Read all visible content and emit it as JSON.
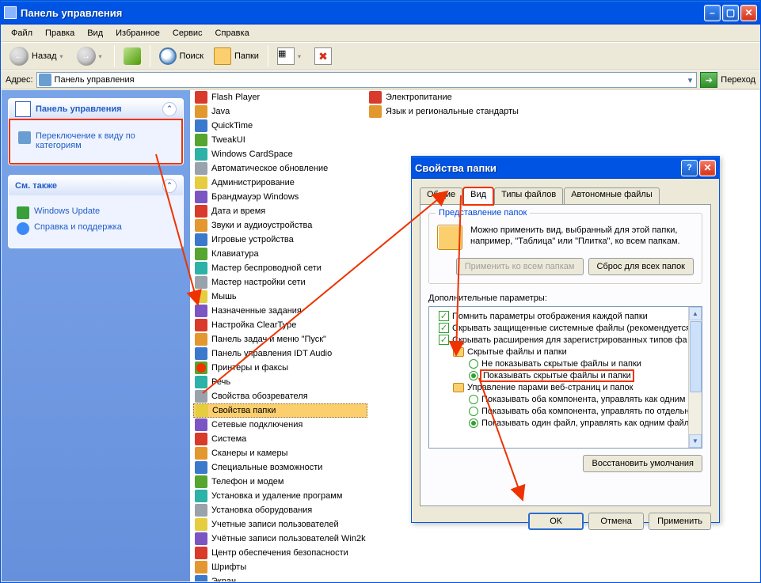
{
  "window": {
    "title": "Панель управления",
    "menu": [
      "Файл",
      "Правка",
      "Вид",
      "Избранное",
      "Сервис",
      "Справка"
    ],
    "toolbar": {
      "back": "Назад",
      "search": "Поиск",
      "folders": "Папки"
    },
    "address": {
      "label": "Адрес:",
      "value": "Панель управления",
      "go": "Переход"
    }
  },
  "sidebar": {
    "box1": {
      "title": "Панель управления",
      "items": [
        {
          "label": "Переключение к виду по категориям"
        }
      ]
    },
    "box2": {
      "title": "См. также",
      "items": [
        {
          "label": "Windows Update"
        },
        {
          "label": "Справка и поддержка"
        }
      ]
    }
  },
  "cp_col1": [
    "Flash Player",
    "Java",
    "QuickTime",
    "TweakUI",
    "Windows CardSpace",
    "Автоматическое обновление",
    "Администрирование",
    "Брандмауэр Windows",
    "Дата и время",
    "Звуки и аудиоустройства",
    "Игровые устройства",
    "Клавиатура",
    "Мастер беспроводной сети",
    "Мастер настройки сети",
    "Мышь",
    "Назначенные задания",
    "Настройка ClearType",
    "Панель задач и меню \"Пуск\"",
    "Панель управления IDT Audio",
    "Принтеры и факсы",
    "Речь",
    "Свойства обозревателя",
    "Свойства папки",
    "Сетевые подключения",
    "Система",
    "Сканеры и камеры",
    "Специальные возможности",
    "Телефон и модем",
    "Установка и удаление программ",
    "Установка оборудования",
    "Учетные записи пользователей",
    "Учётные записи пользователей Win2k",
    "Центр обеспечения безопасности",
    "Шрифты",
    "Экран"
  ],
  "cp_col2": [
    "Электропитание",
    "Язык и региональные стандарты"
  ],
  "dialog": {
    "title": "Свойства папки",
    "tabs": [
      "Общие",
      "Вид",
      "Типы файлов",
      "Автономные файлы"
    ],
    "group1": {
      "title": "Представление папок",
      "text": "Можно применить вид, выбранный для этой папки, например, \"Таблица\" или \"Плитка\", ко всем папкам.",
      "btn_apply_all": "Применить ко всем папкам",
      "btn_reset": "Сброс для всех папок"
    },
    "advanced_label": "Дополнительные параметры:",
    "tree": [
      {
        "type": "check",
        "checked": true,
        "label": "Помнить параметры отображения каждой папки"
      },
      {
        "type": "check",
        "checked": true,
        "label": "Скрывать защищенные системные файлы (рекомендуется"
      },
      {
        "type": "check",
        "checked": true,
        "label": "Скрывать расширения для зарегистрированных типов фа"
      },
      {
        "type": "folder",
        "label": "Скрытые файлы и папки"
      },
      {
        "type": "radio",
        "sel": false,
        "indent": 3,
        "label": "Не показывать скрытые файлы и папки"
      },
      {
        "type": "radio",
        "sel": true,
        "indent": 3,
        "label": "Показывать скрытые файлы и папки",
        "highlight": true
      },
      {
        "type": "folder",
        "label": "Управление парами веб-страниц и папок"
      },
      {
        "type": "radio",
        "sel": false,
        "indent": 3,
        "label": "Показывать оба компонента, управлять как одним фа"
      },
      {
        "type": "radio",
        "sel": false,
        "indent": 3,
        "label": "Показывать оба компонента, управлять по отдельнос"
      },
      {
        "type": "radio",
        "sel": true,
        "indent": 3,
        "label": "Показывать один файл, управлять как одним файлом"
      }
    ],
    "restore": "Восстановить умолчания",
    "ok": "OK",
    "cancel": "Отмена",
    "apply": "Применить"
  }
}
